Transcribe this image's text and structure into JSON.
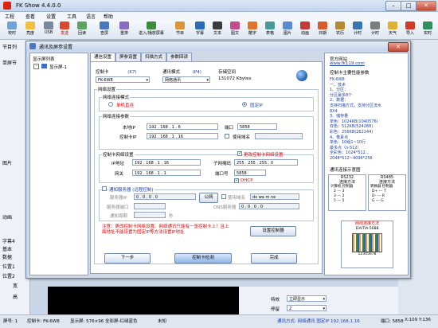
{
  "app": {
    "title": "FK Show 4.4.0.0",
    "menu": [
      "工程",
      "查看",
      "设置",
      "工具",
      "语言",
      "帮助"
    ],
    "toolbar": [
      "校时",
      "亮度",
      "USB",
      "发送",
      "回读",
      "查屏",
      "重排",
      "进入/播放屏幕",
      "节目",
      "字幕",
      "文本",
      "图文",
      "酷字",
      "表格",
      "图片",
      "动画",
      "日期",
      "农历",
      "计时",
      "计时",
      "天气",
      "导入",
      "实时"
    ],
    "left_labels": [
      "节目列",
      "单屏节",
      "图片",
      "动画",
      "字幕4",
      "基本",
      "数据",
      "位置1",
      "位置2",
      "宽",
      "高"
    ],
    "status": {
      "screen": "屏号: 1",
      "card": "控制卡: FK-6W8",
      "display": "显示屏: 576×96 全彩屏-红绿蓝色",
      "state": "未知",
      "connection": "通讯方式: 网络通讯 固定IP 192.168.1.16",
      "port": "端口: 5858",
      "coord": "X:109 Y:136"
    },
    "bottom_right": {
      "label1": "特效",
      "value1": "立即显示",
      "label2": "停留",
      "value2": "2"
    }
  },
  "dialog": {
    "title": "通讯及屏参设置",
    "close_label": "✕",
    "tree_header": "显示屏列表",
    "tree_items": [
      "显示屏-1"
    ],
    "tabs": [
      "通信设置",
      "屏参设置",
      "扫描方式",
      "参数回读"
    ],
    "card": {
      "label": "控制卡",
      "hint": "(K7)",
      "value": "FK-6W8"
    },
    "comm_mode": {
      "label": "通讯模式",
      "hint": "(P4)",
      "value": "网络通讯"
    },
    "storage": {
      "label": "存储空间",
      "value": "131072 Kbytes"
    },
    "net_settings_title": "网络设置",
    "conn_mode_title": "网络连接模式",
    "radio_single": "单机直连",
    "radio_fixed": "固定IP",
    "conn_params_title": "网络连接参数",
    "local_ip_label": "本地IP",
    "local_ip_value": "192 . 168 . 1 . 6",
    "card_ip_label": "控制卡IP",
    "card_ip_value": "192 . 168 . 1 . 16",
    "port_label": "端口",
    "port_value": "5858",
    "use_domain_label": "使用域名",
    "card_net_title": "控制卡网络设置",
    "change_net_label": "更改控制卡网络设置",
    "ip_label": "IP地址",
    "ip_value": "192 . 168 . 1 . 16",
    "gateway_label": "网关",
    "gateway_value": "192 . 168 . 1 . 1",
    "mask_label": "子网掩码",
    "mask_value": "255 . 255 . 255 . 0",
    "port2_label": "端口号",
    "port2_value": "5858",
    "dhcp_label": "DHCP",
    "remote_label": "通知服务器 (远程控制)",
    "server_ip_label": "服务器IP",
    "server_ip_value": "0 . 0 . 0 . 0",
    "public_label": "公网",
    "use_domain2_label": "使用域名",
    "domain_value": "dx wa m ne",
    "server_port_label": "服务器端口",
    "dns_label": "DNS服务器",
    "dns_value": "0 . 0 . 0 . 0",
    "notify_label": "通知周期",
    "notify_unit": "秒",
    "warning": "注意：更改控制卡网络设置、网络通讯只能有一张控制卡上！且上面地址不能设置为固定IP等方法设置IP地址",
    "set_controller_button": "设置控制器",
    "next_button": "下一步",
    "detect_button": "控制卡检测",
    "done_button": "完成",
    "side": {
      "header": "官方网站",
      "url": "www.fk119.com",
      "title": "控制卡主要性能参数",
      "lines": [
        "FK-6W8",
        "一、技术",
        "1、分区：",
        "分区最多8个",
        "2、数据：",
        "支持扫描方式，支持分区流水",
        "8X4",
        "3、储存量",
        "单色：1024KB(1040576)",
        "双色：512KB(524288)",
        "彩色：256KB(262144)",
        "4、像素点",
        "单色：10组1~10行",
        "最多点（n-512）",
        "全彩色：1024*512...",
        "2048*512~4096*256"
      ],
      "diagram_title": "通讯连接示意图",
      "rs232": "RS232\n连接方法",
      "rs485": "RS485\n连接方法",
      "table_rows": [
        "计算机 控制器",
        "2 --- 3",
        "3 --- 2",
        "5 --- 5"
      ],
      "rs485_rows": [
        "转换器 控制器",
        "D+ --- T",
        "D- --- R",
        "G --- G"
      ],
      "net_title": "网线连接方法",
      "net_sub": "EIA/TIA-568B",
      "net_pins": "12345678"
    }
  },
  "colors": {
    "accent": "#1b4bb0",
    "warning": "#e00000",
    "dialog_bg": "#cfd9e8"
  }
}
